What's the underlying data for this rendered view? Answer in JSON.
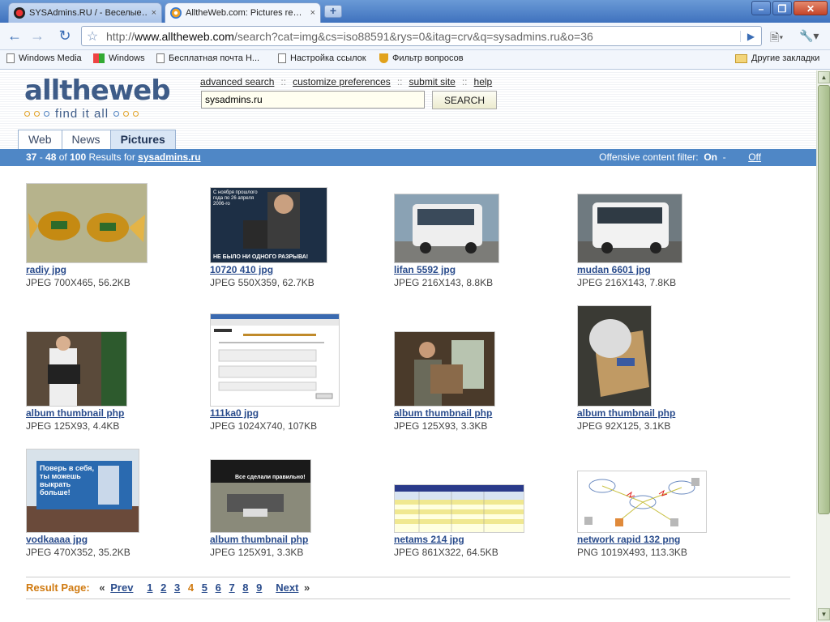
{
  "browser": {
    "tabs": [
      {
        "label": "SYSAdmins.RU / - Веселые…",
        "close": "×"
      },
      {
        "label": "AlltheWeb.com: Pictures re…",
        "close": "×"
      }
    ],
    "new_tab": "+",
    "window_buttons": {
      "minimize": "–",
      "maximize": "❐",
      "close": "✕"
    },
    "url_prefix": "http://",
    "url_domain": "www.alltheweb.com",
    "url_rest": "/search?cat=img&cs=iso88591&rys=0&itag=crv&q=sysadmins.ru&o=36",
    "bookmarks": [
      "Windows Media",
      "Windows",
      "Бесплатная почта Н...",
      "Настройка ссылок",
      "Фильтр вопросов"
    ],
    "other_bookmarks": "Другие закладки"
  },
  "site": {
    "logo_text": "alltheweb",
    "tagline": "find it all",
    "links": [
      "advanced search",
      "customize preferences",
      "submit site",
      "help"
    ],
    "link_sep": "::",
    "search_value": "sysadmins.ru",
    "search_button": "SEARCH",
    "tabs": [
      "Web",
      "News",
      "Pictures"
    ],
    "active_tab": "Pictures"
  },
  "results_bar": {
    "range_start": "37",
    "range_end": "48",
    "of": "of",
    "total": "100",
    "results_for": "Results for",
    "query": "sysadmins.ru",
    "filter_label": "Offensive content filter:",
    "filter_on": "On",
    "filter_dash": "-",
    "filter_off": "Off"
  },
  "results": [
    {
      "title": "radiy jpg",
      "meta": "JPEG 700X465, 56.2KB"
    },
    {
      "title": "10720 410 jpg",
      "meta": "JPEG 550X359, 62.7KB"
    },
    {
      "title": "lifan 5592 jpg",
      "meta": "JPEG 216X143, 8.8KB"
    },
    {
      "title": "mudan 6601 jpg",
      "meta": "JPEG 216X143, 7.8KB"
    },
    {
      "title": "album thumbnail php",
      "meta": "JPEG 125X93, 4.4KB"
    },
    {
      "title": "111ka0 jpg",
      "meta": "JPEG 1024X740, 107KB"
    },
    {
      "title": "album thumbnail php",
      "meta": "JPEG 125X93, 3.3KB"
    },
    {
      "title": "album thumbnail php",
      "meta": "JPEG 92X125, 3.1KB"
    },
    {
      "title": "vodkaaaa jpg",
      "meta": "JPEG 470X352, 35.2KB"
    },
    {
      "title": "album thumbnail php",
      "meta": "JPEG 125X91, 3.3KB"
    },
    {
      "title": "netams 214 jpg",
      "meta": "JPEG 861X322, 64.5KB"
    },
    {
      "title": "network rapid 132 png",
      "meta": "PNG 1019X493, 113.3KB"
    }
  ],
  "thumb_text": {
    "poster_top": "С ноября прошлого года по 26 апреля 2006-го",
    "poster_bottom": "НЕ БЫЛО НИ ОДНОГО РАЗРЫВА!",
    "billboard": "Поверь в себя, ты можешь выкрать больше!",
    "meme": "Все сделали правильно!"
  },
  "pager": {
    "label": "Result Page:",
    "prev": "Prev",
    "pages": [
      "1",
      "2",
      "3",
      "4",
      "5",
      "6",
      "7",
      "8",
      "9"
    ],
    "current": "4",
    "next": "Next",
    "lt": "«",
    "gt": "»"
  },
  "colors": {
    "accent_bar": "#4f87c6",
    "link": "#2a4c8c",
    "current_page": "#d07a10"
  }
}
